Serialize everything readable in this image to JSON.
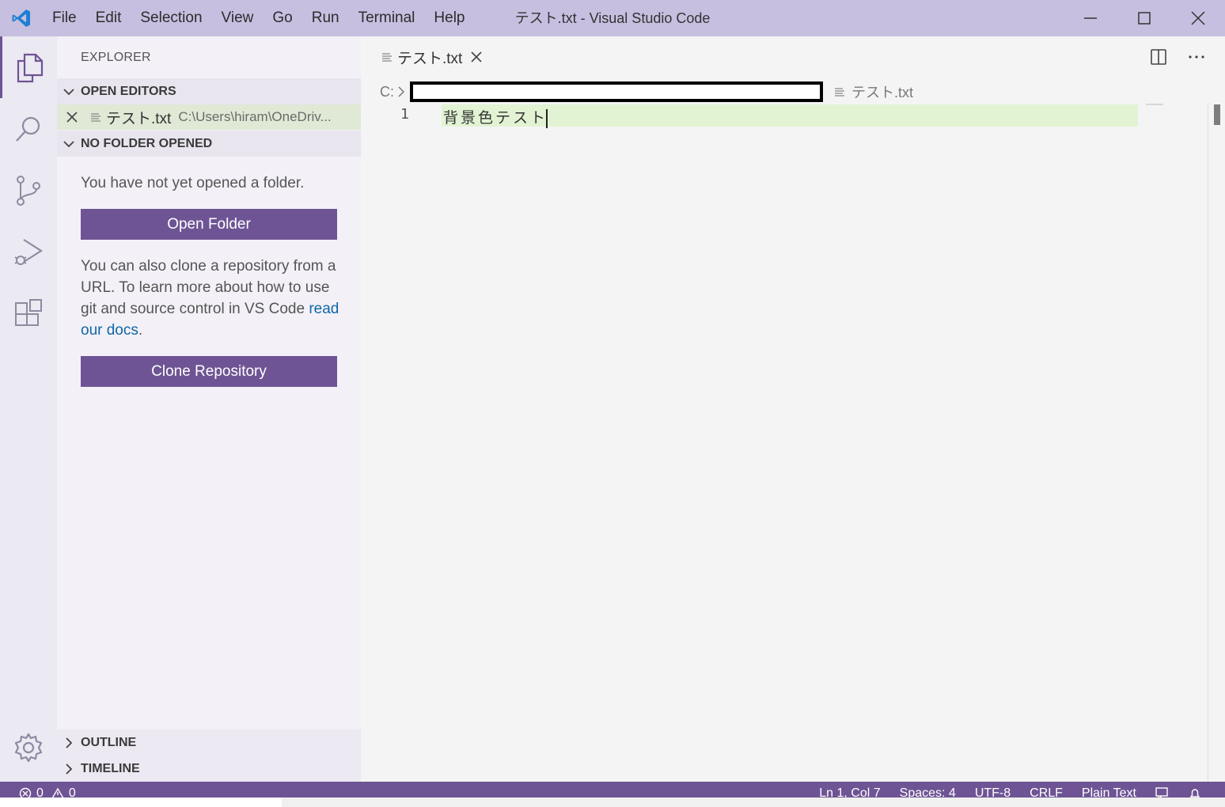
{
  "titlebar": {
    "menu": [
      "File",
      "Edit",
      "Selection",
      "View",
      "Go",
      "Run",
      "Terminal",
      "Help"
    ],
    "window_title": "テスト.txt - Visual Studio Code"
  },
  "activity_bar": {
    "icons": [
      "explorer-icon",
      "search-icon",
      "source-control-icon",
      "run-debug-icon",
      "extensions-icon",
      "gear-icon"
    ]
  },
  "sidebar": {
    "title": "EXPLORER",
    "open_editors": {
      "header": "OPEN EDITORS",
      "items": [
        {
          "name": "テスト.txt",
          "path": "C:\\Users\\hiram\\OneDriv..."
        }
      ]
    },
    "no_folder": {
      "header": "NO FOLDER OPENED",
      "message": "You have not yet opened a folder.",
      "open_folder_button": "Open Folder",
      "clone_text": "You can also clone a repository from a URL. To learn more about how to use git and source control in VS Code",
      "docs_link": "read our docs",
      "period": ".",
      "clone_button": "Clone Repository"
    },
    "outline": "OUTLINE",
    "timeline": "TIMELINE"
  },
  "editor": {
    "tab": {
      "label": "テスト.txt"
    },
    "breadcrumb": {
      "root": "C:",
      "file": "テスト.txt"
    },
    "lines": [
      {
        "number": "1",
        "text": "背景色テスト"
      }
    ]
  },
  "statusbar": {
    "errors": "0",
    "warnings": "0",
    "position": "Ln 1, Col 7",
    "spaces": "Spaces: 4",
    "encoding": "UTF-8",
    "eol": "CRLF",
    "language": "Plain Text"
  },
  "colors": {
    "titlebar": "#c6bfe0",
    "accent": "#6e5494",
    "line_highlight": "#e2f3d3",
    "link": "#1066a8"
  }
}
